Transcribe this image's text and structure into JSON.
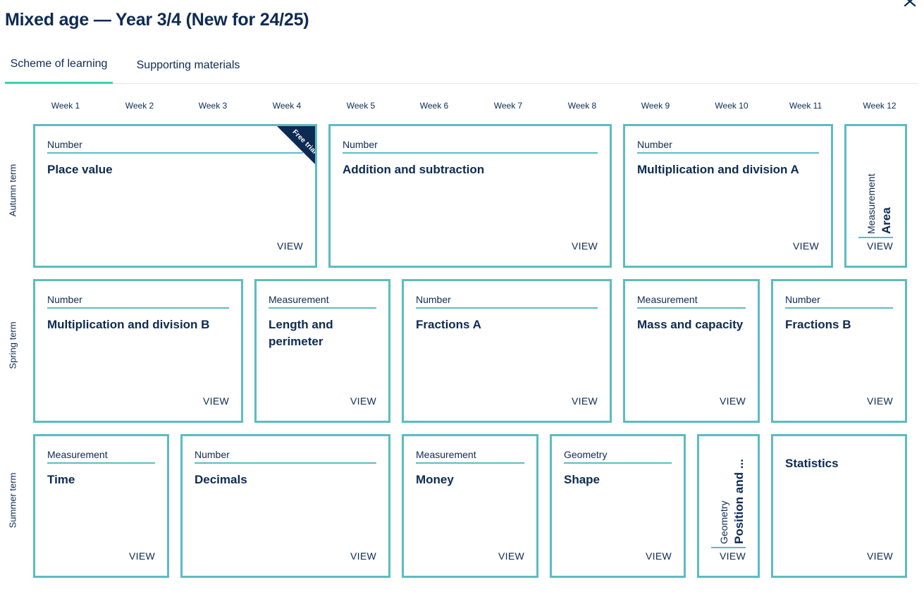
{
  "title": "Mixed age — Year 3/4 (New for 24/25)",
  "tabs": [
    "Scheme of learning",
    "Supporting materials"
  ],
  "weeks": [
    "Week 1",
    "Week 2",
    "Week 3",
    "Week 4",
    "Week 5",
    "Week 6",
    "Week 7",
    "Week 8",
    "Week 9",
    "Week 10",
    "Week 11",
    "Week 12"
  ],
  "terms": [
    "Autumn term",
    "Spring term",
    "Summer term"
  ],
  "view_label": "VIEW",
  "ribbon_label": "Free trial",
  "autumn": [
    {
      "strand": "Number",
      "topic": "Place value"
    },
    {
      "strand": "Number",
      "topic": "Addition and subtraction"
    },
    {
      "strand": "Number",
      "topic": "Multiplication and division A"
    },
    {
      "strand": "Measurement",
      "topic": "Area"
    }
  ],
  "spring": [
    {
      "strand": "Number",
      "topic": "Multiplication and division B"
    },
    {
      "strand": "Measurement",
      "topic": "Length and perimeter"
    },
    {
      "strand": "Number",
      "topic": "Fractions A"
    },
    {
      "strand": "Measurement",
      "topic": "Mass and capacity"
    },
    {
      "strand": "Number",
      "topic": "Fractions B"
    }
  ],
  "summer": [
    {
      "strand": "Measurement",
      "topic": "Time"
    },
    {
      "strand": "Number",
      "topic": "Decimals"
    },
    {
      "strand": "Measurement",
      "topic": "Money"
    },
    {
      "strand": "Geometry",
      "topic": "Shape"
    },
    {
      "strand": "Geometry",
      "topic": "Position and ..."
    },
    {
      "topic": "Statistics"
    }
  ],
  "colors": {
    "navy": "#0d2a52",
    "card_border": "#5cbcc1",
    "tab_active": "#3ad2b0"
  }
}
